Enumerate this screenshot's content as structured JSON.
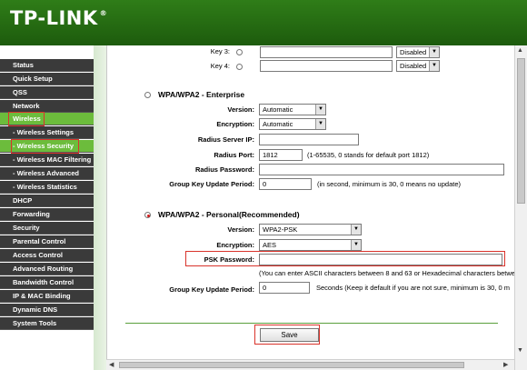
{
  "brand": {
    "logo": "TP-LINK",
    "mark": "®"
  },
  "sidebar": {
    "items": [
      {
        "label": "Status",
        "top": 0
      },
      {
        "label": "Quick Setup"
      },
      {
        "label": "QSS"
      },
      {
        "label": "Network"
      },
      {
        "label": "Wireless"
      },
      {
        "label": "- Wireless Settings"
      },
      {
        "label": "- Wireless Security"
      },
      {
        "label": "- Wireless MAC Filtering"
      },
      {
        "label": "- Wireless Advanced"
      },
      {
        "label": "- Wireless Statistics"
      },
      {
        "label": "DHCP"
      },
      {
        "label": "Forwarding"
      },
      {
        "label": "Security"
      },
      {
        "label": "Parental Control"
      },
      {
        "label": "Access Control"
      },
      {
        "label": "Advanced Routing"
      },
      {
        "label": "Bandwidth Control"
      },
      {
        "label": "IP & MAC Binding"
      },
      {
        "label": "Dynamic DNS"
      },
      {
        "label": "System Tools"
      }
    ]
  },
  "wep": {
    "key3_label": "Key 3:",
    "key4_label": "Key 4:",
    "key3_status": "Disabled",
    "key4_status": "Disabled"
  },
  "enterprise": {
    "title": "WPA/WPA2 - Enterprise",
    "version_label": "Version:",
    "version_value": "Automatic",
    "encryption_label": "Encryption:",
    "encryption_value": "Automatic",
    "server_ip_label": "Radius Server IP:",
    "server_ip_value": "",
    "port_label": "Radius Port:",
    "port_value": "1812",
    "port_hint": "(1-65535, 0 stands for default port 1812)",
    "password_label": "Radius Password:",
    "password_value": "",
    "group_key_label": "Group Key Update Period:",
    "group_key_value": "0",
    "group_key_hint": "(in second, minimum is 30, 0 means no update)"
  },
  "personal": {
    "title": "WPA/WPA2 - Personal(Recommended)",
    "version_label": "Version:",
    "version_value": "WPA2-PSK",
    "encryption_label": "Encryption:",
    "encryption_value": "AES",
    "psk_label": "PSK Password:",
    "psk_value": "",
    "psk_hint": "(You can enter ASCII characters between 8 and 63 or Hexadecimal characters betwe",
    "group_key_label": "Group Key Update Period:",
    "group_key_value": "0",
    "group_key_hint": "Seconds (Keep it default if you are not sure, minimum is 30, 0 m"
  },
  "actions": {
    "save_label": "Save"
  },
  "colors": {
    "header_green": "#2f7d18",
    "active_nav": "#6cbc3c",
    "highlight_red": "#d9332b"
  }
}
